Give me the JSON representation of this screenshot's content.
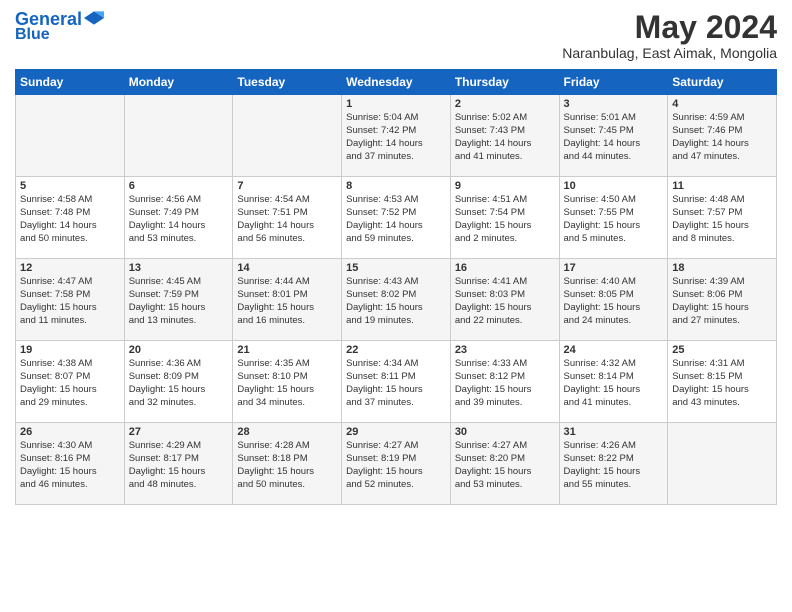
{
  "logo": {
    "line1": "General",
    "line2": "Blue"
  },
  "title": "May 2024",
  "location": "Naranbulag, East Aimak, Mongolia",
  "days_of_week": [
    "Sunday",
    "Monday",
    "Tuesday",
    "Wednesday",
    "Thursday",
    "Friday",
    "Saturday"
  ],
  "weeks": [
    [
      {
        "day": "",
        "info": ""
      },
      {
        "day": "",
        "info": ""
      },
      {
        "day": "",
        "info": ""
      },
      {
        "day": "1",
        "info": "Sunrise: 5:04 AM\nSunset: 7:42 PM\nDaylight: 14 hours\nand 37 minutes."
      },
      {
        "day": "2",
        "info": "Sunrise: 5:02 AM\nSunset: 7:43 PM\nDaylight: 14 hours\nand 41 minutes."
      },
      {
        "day": "3",
        "info": "Sunrise: 5:01 AM\nSunset: 7:45 PM\nDaylight: 14 hours\nand 44 minutes."
      },
      {
        "day": "4",
        "info": "Sunrise: 4:59 AM\nSunset: 7:46 PM\nDaylight: 14 hours\nand 47 minutes."
      }
    ],
    [
      {
        "day": "5",
        "info": "Sunrise: 4:58 AM\nSunset: 7:48 PM\nDaylight: 14 hours\nand 50 minutes."
      },
      {
        "day": "6",
        "info": "Sunrise: 4:56 AM\nSunset: 7:49 PM\nDaylight: 14 hours\nand 53 minutes."
      },
      {
        "day": "7",
        "info": "Sunrise: 4:54 AM\nSunset: 7:51 PM\nDaylight: 14 hours\nand 56 minutes."
      },
      {
        "day": "8",
        "info": "Sunrise: 4:53 AM\nSunset: 7:52 PM\nDaylight: 14 hours\nand 59 minutes."
      },
      {
        "day": "9",
        "info": "Sunrise: 4:51 AM\nSunset: 7:54 PM\nDaylight: 15 hours\nand 2 minutes."
      },
      {
        "day": "10",
        "info": "Sunrise: 4:50 AM\nSunset: 7:55 PM\nDaylight: 15 hours\nand 5 minutes."
      },
      {
        "day": "11",
        "info": "Sunrise: 4:48 AM\nSunset: 7:57 PM\nDaylight: 15 hours\nand 8 minutes."
      }
    ],
    [
      {
        "day": "12",
        "info": "Sunrise: 4:47 AM\nSunset: 7:58 PM\nDaylight: 15 hours\nand 11 minutes."
      },
      {
        "day": "13",
        "info": "Sunrise: 4:45 AM\nSunset: 7:59 PM\nDaylight: 15 hours\nand 13 minutes."
      },
      {
        "day": "14",
        "info": "Sunrise: 4:44 AM\nSunset: 8:01 PM\nDaylight: 15 hours\nand 16 minutes."
      },
      {
        "day": "15",
        "info": "Sunrise: 4:43 AM\nSunset: 8:02 PM\nDaylight: 15 hours\nand 19 minutes."
      },
      {
        "day": "16",
        "info": "Sunrise: 4:41 AM\nSunset: 8:03 PM\nDaylight: 15 hours\nand 22 minutes."
      },
      {
        "day": "17",
        "info": "Sunrise: 4:40 AM\nSunset: 8:05 PM\nDaylight: 15 hours\nand 24 minutes."
      },
      {
        "day": "18",
        "info": "Sunrise: 4:39 AM\nSunset: 8:06 PM\nDaylight: 15 hours\nand 27 minutes."
      }
    ],
    [
      {
        "day": "19",
        "info": "Sunrise: 4:38 AM\nSunset: 8:07 PM\nDaylight: 15 hours\nand 29 minutes."
      },
      {
        "day": "20",
        "info": "Sunrise: 4:36 AM\nSunset: 8:09 PM\nDaylight: 15 hours\nand 32 minutes."
      },
      {
        "day": "21",
        "info": "Sunrise: 4:35 AM\nSunset: 8:10 PM\nDaylight: 15 hours\nand 34 minutes."
      },
      {
        "day": "22",
        "info": "Sunrise: 4:34 AM\nSunset: 8:11 PM\nDaylight: 15 hours\nand 37 minutes."
      },
      {
        "day": "23",
        "info": "Sunrise: 4:33 AM\nSunset: 8:12 PM\nDaylight: 15 hours\nand 39 minutes."
      },
      {
        "day": "24",
        "info": "Sunrise: 4:32 AM\nSunset: 8:14 PM\nDaylight: 15 hours\nand 41 minutes."
      },
      {
        "day": "25",
        "info": "Sunrise: 4:31 AM\nSunset: 8:15 PM\nDaylight: 15 hours\nand 43 minutes."
      }
    ],
    [
      {
        "day": "26",
        "info": "Sunrise: 4:30 AM\nSunset: 8:16 PM\nDaylight: 15 hours\nand 46 minutes."
      },
      {
        "day": "27",
        "info": "Sunrise: 4:29 AM\nSunset: 8:17 PM\nDaylight: 15 hours\nand 48 minutes."
      },
      {
        "day": "28",
        "info": "Sunrise: 4:28 AM\nSunset: 8:18 PM\nDaylight: 15 hours\nand 50 minutes."
      },
      {
        "day": "29",
        "info": "Sunrise: 4:27 AM\nSunset: 8:19 PM\nDaylight: 15 hours\nand 52 minutes."
      },
      {
        "day": "30",
        "info": "Sunrise: 4:27 AM\nSunset: 8:20 PM\nDaylight: 15 hours\nand 53 minutes."
      },
      {
        "day": "31",
        "info": "Sunrise: 4:26 AM\nSunset: 8:22 PM\nDaylight: 15 hours\nand 55 minutes."
      },
      {
        "day": "",
        "info": ""
      }
    ]
  ]
}
